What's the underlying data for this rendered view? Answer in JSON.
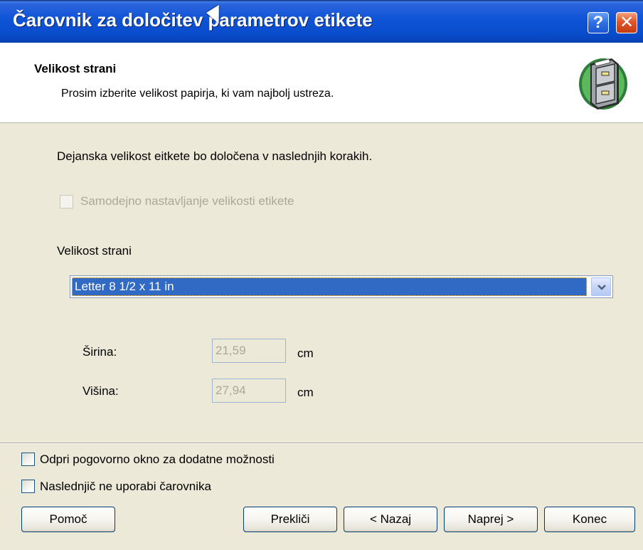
{
  "window": {
    "title": "Čarovnik za določitev parametrov etikete",
    "help_button": "?",
    "close_button": "✕"
  },
  "header": {
    "title": "Velikost strani",
    "subtitle": "Prosim izberite velikost papirja, ki vam najbolj ustreza.",
    "icon": "file-cabinet-icon"
  },
  "body": {
    "info_text": "Dejanska velikost eitkete bo določena v naslednjih korakih.",
    "auto_size_checkbox": {
      "label": "Samodejno nastavljanje velikosti etikete",
      "checked": false,
      "enabled": false
    },
    "page_size_label": "Velikost strani",
    "page_size_select": {
      "selected": "Letter 8 1/2 x 11 in"
    },
    "width": {
      "label": "Širina:",
      "value": "21,59",
      "unit": "cm"
    },
    "height": {
      "label": "Višina:",
      "value": "27,94",
      "unit": "cm"
    }
  },
  "footer": {
    "open_dialog_checkbox": {
      "label": "Odpri pogovorno okno za dodatne možnosti",
      "checked": false
    },
    "no_wizard_checkbox": {
      "label": "Naslednjič ne uporabi čarovnika",
      "checked": false
    },
    "buttons": {
      "help": "Pomoč",
      "cancel": "Prekliči",
      "back": "< Nazaj",
      "next": "Naprej >",
      "finish": "Konec"
    }
  },
  "colors": {
    "title_bar": "#0b4fd0",
    "dialog_bg": "#ece9d8",
    "selection": "#316ac5"
  }
}
